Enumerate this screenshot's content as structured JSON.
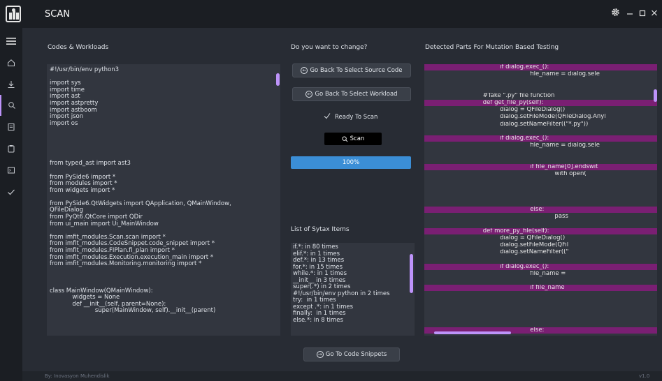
{
  "window": {
    "title": "SCAN"
  },
  "colors": {
    "accent": "#bd93f9",
    "highlight": "#7a1f73",
    "progress": "#3b8ed6",
    "bg": "#282c34",
    "panel": "#32363f"
  },
  "menu": {
    "items": [
      {
        "name": "toggle-menu-icon"
      },
      {
        "name": "home-icon"
      },
      {
        "name": "download-icon"
      },
      {
        "name": "search-icon"
      },
      {
        "name": "document-icon"
      },
      {
        "name": "clipboard-icon"
      },
      {
        "name": "terminal-icon"
      },
      {
        "name": "check-icon"
      }
    ]
  },
  "codes": {
    "label": "Codes & Workloads",
    "text": "#!/usr/bin/env python3\n\nimport sys\nimport time\nimport ast\nimport astpretty\nimport astboom\nimport json\nimport os\n\n\n\n\n\nfrom typed_ast import ast3\n\nfrom PySide6 import *\nfrom modules import *\nfrom widgets import *\n\nfrom PySide6.QtWidgets import QApplication, QMainWindow,\nQFileDialog\nfrom PyQt6.QtCore import QDir\nfrom ui_main import Ui_MainWindow\n\nfrom imfit_modules.Scan.scan import *\nfrom imfit_modules.CodeSnippet.code_snippet import *\nfrom imfit_modules.FIPlan.fi_plan import *\nfrom imfit_modules.Execution.execution_main import *\nfrom imfit_modules.Monitoring.monitoring import *\n\n\n\nclass MainWindow(QMainWindow):\n            widgets = None\n            def __init__(self, parent=None):\n                        super(MainWindow, self).__init__(parent)"
  },
  "change": {
    "label": "Do you want to change?",
    "back_source": "Go Back To Select Source Code",
    "back_workload": "Go Back To Select Workload",
    "ready": "Ready To Scan",
    "scan": "Scan",
    "progress_text": "100%",
    "progress_value": 100
  },
  "syntax": {
    "label": "List of Sytax Items",
    "text": "if.*: in 80 times\nelif.*: in 1 times\ndef.*: in 13 times\nfor.*: in 15 times\nwhile.*: in 1 times\n__init__ in 3 times\nsuper(.*) in 2 times\n#!/usr/bin/env python in 2 times\ntry:  in 1 times\nexcept .*: in 1 times\nfinally:  in 1 times\nelse.*: in 8 times"
  },
  "detected": {
    "label": "Detected Parts For Mutation Based Testing",
    "lines": [
      {
        "text": "                                        if dialog.exec_():",
        "hl": true
      },
      {
        "text": "                                                        file_name = dialog.sele",
        "hl": false
      },
      {
        "text": "",
        "hl": false
      },
      {
        "text": "",
        "hl": false
      },
      {
        "text": "                               #Take \".py\" file function",
        "hl": false
      },
      {
        "text": "                               def get_file_py(self):",
        "hl": true
      },
      {
        "text": "                                        dialog = QFileDialog()",
        "hl": false
      },
      {
        "text": "                                        dialog.setFileMode(QFileDialog.Anyl",
        "hl": false
      },
      {
        "text": "                                        dialog.setNameFilter((\"*.py\"))",
        "hl": false
      },
      {
        "text": "",
        "hl": false
      },
      {
        "text": "                                        if dialog.exec_():",
        "hl": true
      },
      {
        "text": "                                                        file_name = dialog.sele",
        "hl": false
      },
      {
        "text": "",
        "hl": false
      },
      {
        "text": "",
        "hl": false
      },
      {
        "text": "                                                        if file_name[0].endswit",
        "hl": true
      },
      {
        "text": "                                                                     with open(",
        "hl": false
      },
      {
        "text": "",
        "hl": false
      },
      {
        "text": "",
        "hl": false
      },
      {
        "text": "",
        "hl": false
      },
      {
        "text": "",
        "hl": false
      },
      {
        "text": "                                                        else:",
        "hl": true
      },
      {
        "text": "                                                                     pass",
        "hl": false
      },
      {
        "text": "",
        "hl": false
      },
      {
        "text": "                               def more_py_file(self):",
        "hl": true
      },
      {
        "text": "                                        dialog = QFileDialog()",
        "hl": false
      },
      {
        "text": "                                        dialog.setFileMode(QFil",
        "hl": false
      },
      {
        "text": "                                        dialog.setNameFilter((\"",
        "hl": false
      },
      {
        "text": "",
        "hl": false
      },
      {
        "text": "                                        if dialog.exec_():",
        "hl": true
      },
      {
        "text": "                                                        file_name =",
        "hl": false
      },
      {
        "text": "",
        "hl": false
      },
      {
        "text": "                                                        if file_name",
        "hl": true
      },
      {
        "text": "",
        "hl": false
      },
      {
        "text": "",
        "hl": false
      },
      {
        "text": "",
        "hl": false
      },
      {
        "text": "",
        "hl": false
      },
      {
        "text": "",
        "hl": false
      },
      {
        "text": "                                                        else:",
        "hl": true
      }
    ]
  },
  "snippets": {
    "label": "Go To Code Snippets"
  },
  "footer": {
    "credits": "By: Inovasyon Muhendislik",
    "version": "v1.0"
  }
}
